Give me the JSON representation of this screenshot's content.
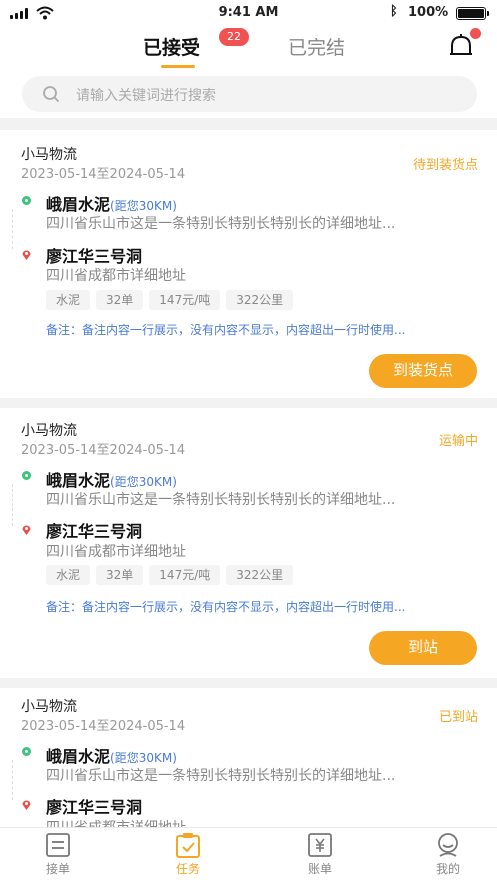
{
  "status_bar": {
    "time": "9:41 AM",
    "battery": "100%"
  },
  "header": {
    "tabs": [
      {
        "label": "已接受",
        "badge": "22"
      },
      {
        "label": "已完结"
      }
    ]
  },
  "search": {
    "placeholder": "请输入关键词进行搜索"
  },
  "orders": [
    {
      "company": "小马物流",
      "date_range": "2023-05-14至2024-05-14",
      "status": "待到装货点",
      "origin": {
        "name": "峨眉水泥",
        "distance": "(距您30KM)",
        "address": "四川省乐山市这是一条特别长特别长特别长的详细地址..."
      },
      "destination": {
        "name": "廖江华三号洞",
        "address": "四川省成都市详细地址"
      },
      "tags": [
        "水泥",
        "32单",
        "147元/吨",
        "322公里"
      ],
      "note": "备注：备注内容一行展示，没有内容不显示，内容超出一行时使用...",
      "action": "到装货点"
    },
    {
      "company": "小马物流",
      "date_range": "2023-05-14至2024-05-14",
      "status": "运输中",
      "origin": {
        "name": "峨眉水泥",
        "distance": "(距您30KM)",
        "address": "四川省乐山市这是一条特别长特别长特别长的详细地址..."
      },
      "destination": {
        "name": "廖江华三号洞",
        "address": "四川省成都市详细地址"
      },
      "tags": [
        "水泥",
        "32单",
        "147元/吨",
        "322公里"
      ],
      "note": "备注：备注内容一行展示，没有内容不显示，内容超出一行时使用...",
      "action": "到站"
    },
    {
      "company": "小马物流",
      "date_range": "2023-05-14至2024-05-14",
      "status": "已到站",
      "origin": {
        "name": "峨眉水泥",
        "distance": "(距您30KM)",
        "address": "四川省乐山市这是一条特别长特别长特别长的详细地址..."
      },
      "destination": {
        "name": "廖江华三号洞",
        "address": "四川省成都市详细地址"
      }
    }
  ],
  "tabbar": [
    {
      "label": "接单",
      "icon": "list-icon"
    },
    {
      "label": "任务",
      "icon": "clipboard-check-icon",
      "active": true
    },
    {
      "label": "账单",
      "icon": "yuan-bill-icon"
    },
    {
      "label": "我的",
      "icon": "profile-icon"
    }
  ],
  "colors": {
    "accent": "#f5a623",
    "badge": "#f05252",
    "link": "#4a7bd6",
    "origin_dot": "#3cc47c",
    "dest_pin": "#e8514b"
  }
}
